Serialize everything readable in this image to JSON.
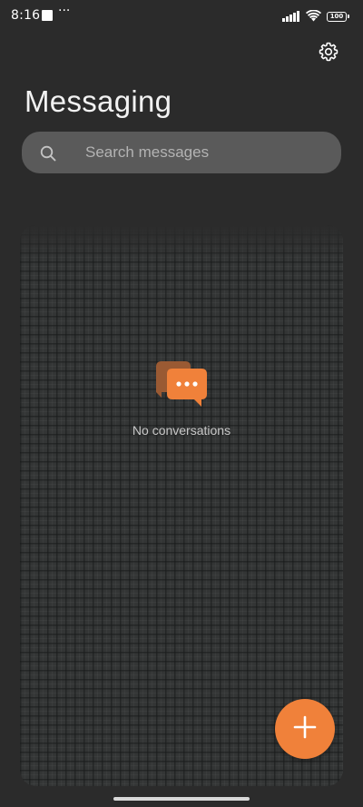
{
  "status_bar": {
    "time": "8:16",
    "overflow_dots": "···",
    "battery_level": "100",
    "icons": [
      "notification-square-icon",
      "signal-icon",
      "wifi-icon",
      "battery-icon"
    ]
  },
  "header": {
    "title": "Messaging",
    "settings_icon": "gear-icon"
  },
  "search": {
    "placeholder": "Search messages",
    "value": "",
    "icon": "search-icon"
  },
  "conversations": {
    "items": [],
    "empty_text": "No conversations",
    "empty_icon": "chat-bubbles-icon"
  },
  "fab": {
    "icon": "plus-icon"
  },
  "colors": {
    "background": "#2b2b2b",
    "search_background": "#5a5a5a",
    "accent": "#f0813a",
    "accent_dark": "#b86a3a",
    "text_primary": "#f2f2f2",
    "text_secondary": "#c8c8c8"
  }
}
